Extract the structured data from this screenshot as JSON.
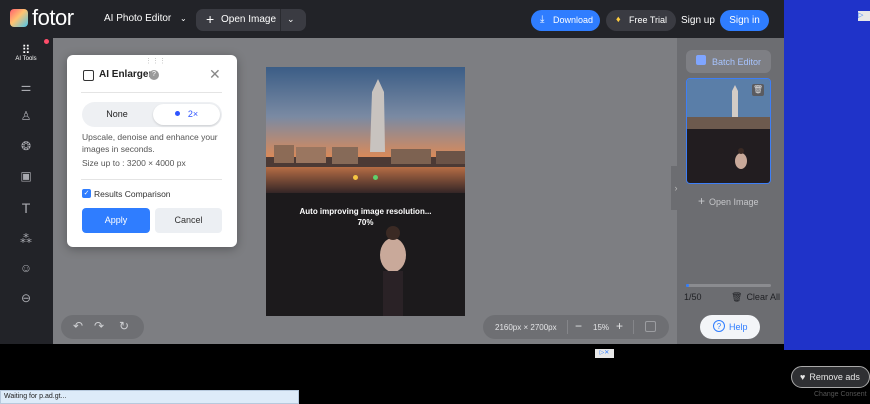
{
  "topbar": {
    "brand": "fotor",
    "editor_menu": "AI Photo Editor",
    "open_image": "Open Image",
    "download": "Download",
    "free_trial": "Free Trial",
    "sign_up": "Sign up",
    "sign_in": "Sign in"
  },
  "left_toolbar": {
    "ai_tools_label": "AI Tools"
  },
  "dialog": {
    "title": "AI Enlarger",
    "option_none": "None",
    "option_2x": "2×",
    "description": "Upscale, denoise and enhance your images in seconds.",
    "size_limit": "Size up to : 3200 × 4000 px",
    "results_comparison": "Results Comparison",
    "results_comparison_checked": true,
    "apply": "Apply",
    "cancel": "Cancel"
  },
  "canvas": {
    "status_text": "Auto improving image resolution...",
    "progress": "70%"
  },
  "zoom_bar": {
    "dimensions": "2160px × 2700px",
    "minus": "−",
    "zoom": "15%",
    "plus": "+"
  },
  "right_panel": {
    "batch_editor": "Batch Editor",
    "open_image": "Open Image",
    "count": "1/50",
    "clear_all": "Clear All",
    "help": "Help"
  },
  "ads": {
    "remove_ads": "Remove ads",
    "change_consent": "Change Consent"
  },
  "status_bar": {
    "text": "Waiting for p.ad.gt..."
  },
  "colors": {
    "accent": "#2f7dff",
    "toolbar": "#222328",
    "canvas": "#7d7e82",
    "ad_background": "#1f33c9"
  }
}
